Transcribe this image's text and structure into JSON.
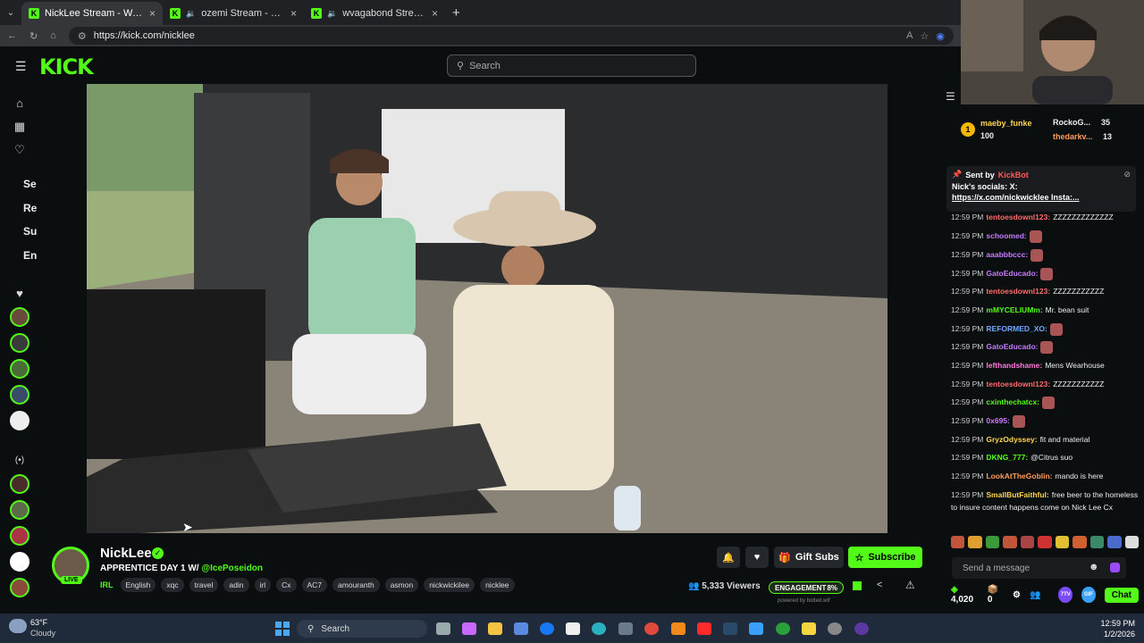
{
  "browser": {
    "tabs": [
      {
        "label": "NickLee Stream - Watch Live on Kick",
        "active": true
      },
      {
        "label": "ozemi Stream - Watch Live on Kick",
        "active": false
      },
      {
        "label": "wvagabond Stream - Watch Live on Kick",
        "active": false
      }
    ],
    "new_tab": "+",
    "url": "https://kick.com/nicklee"
  },
  "header": {
    "logo": "KICK",
    "search_placeholder": "Search"
  },
  "sidebar": {
    "labels": [
      "Se",
      "Re",
      "Su",
      "En"
    ]
  },
  "channel": {
    "name": "NickLee",
    "live_badge": "LIVE",
    "title_prefix": "APPRENTICE DAY 1 W/ ",
    "title_mention": "@IcePoseidon",
    "category": "IRL",
    "tags": [
      "English",
      "xqc",
      "travel",
      "adin",
      "irl",
      "Cx",
      "AC7",
      "amouranth",
      "asmon",
      "nickwickilee",
      "nicklee"
    ],
    "gift_subs_label": "Gift Subs",
    "subscribe_label": "Subscribe",
    "viewers": "5,333 Viewers",
    "engagement_label": "ENGAGEMENT",
    "engagement_value": "8%",
    "powered_by": "powered by botted.wtf"
  },
  "chat": {
    "leaderboard": [
      {
        "rank": "1",
        "name": "maeby_funke",
        "value": "100"
      },
      {
        "name": "RockoG...",
        "value": "35"
      },
      {
        "name": "thedarkv...",
        "value": "13"
      }
    ],
    "pinned": {
      "sent_by": "Sent by",
      "bot": "KickBot",
      "text": "Nick's socials: X:",
      "link": "https://x.com/nickwicklee Insta:..."
    },
    "messages": [
      {
        "time": "12:59 PM",
        "user": "tentoesdownl123:",
        "text": "ZZZZZZZZZZZZZ",
        "color": "#ff6b6b"
      },
      {
        "time": "12:59 PM",
        "user": "schoomed:",
        "text": "",
        "color": "#c67bff",
        "emote": true
      },
      {
        "time": "12:59 PM",
        "user": "aaabbbccc:",
        "text": "",
        "color": "#c67bff",
        "emote": true
      },
      {
        "time": "12:59 PM",
        "user": "GatoEducado:",
        "text": "",
        "color": "#c67bff",
        "emote": true
      },
      {
        "time": "12:59 PM",
        "user": "tentoesdownl123:",
        "text": "ZZZZZZZZZZZ",
        "color": "#ff6b6b"
      },
      {
        "time": "12:59 PM",
        "user": "mMYCELIUMm:",
        "text": "Mr. bean suit",
        "color": "#53fc18"
      },
      {
        "time": "12:59 PM",
        "user": "REFORMED_XO:",
        "text": "",
        "color": "#6fa8ff",
        "emote": true
      },
      {
        "time": "12:59 PM",
        "user": "GatoEducado:",
        "text": "",
        "color": "#c67bff",
        "emote": true
      },
      {
        "time": "12:59 PM",
        "user": "lefthandshame:",
        "text": "Mens Wearhouse",
        "color": "#ff7ad9"
      },
      {
        "time": "12:59 PM",
        "user": "tentoesdownl123:",
        "text": "ZZZZZZZZZZZ",
        "color": "#ff6b6b"
      },
      {
        "time": "12:59 PM",
        "user": "cxinthechatcx:",
        "text": "",
        "color": "#53fc18",
        "emote": true
      },
      {
        "time": "12:59 PM",
        "user": "0x695:",
        "text": "",
        "color": "#c67bff",
        "emote": true
      },
      {
        "time": "12:59 PM",
        "user": "GryzOdyssey:",
        "text": "fit and material",
        "color": "#ffd54f"
      },
      {
        "time": "12:59 PM",
        "user": "DKNG_777:",
        "text": "@Citrus suo",
        "color": "#53fc18"
      },
      {
        "time": "12:59 PM",
        "user": "LookAtTheGoblin:",
        "text": "mando is here",
        "color": "#ff9c5b"
      },
      {
        "time": "12:59 PM",
        "user": "SmallButFaithful:",
        "text": "free beer to the homeless to insure content happens come on Nick Lee Cx",
        "color": "#ffd54f"
      }
    ],
    "input_placeholder": "Send a message",
    "points": "4,020",
    "count": "0",
    "chat_button": "Chat"
  },
  "taskbar": {
    "weather_temp": "63°F",
    "weather_desc": "Cloudy",
    "search": "Search",
    "time": "12:59 PM",
    "date": "1/2/2026"
  },
  "colors": {
    "brand": "#53fc18",
    "background": "#0b0e0f"
  }
}
